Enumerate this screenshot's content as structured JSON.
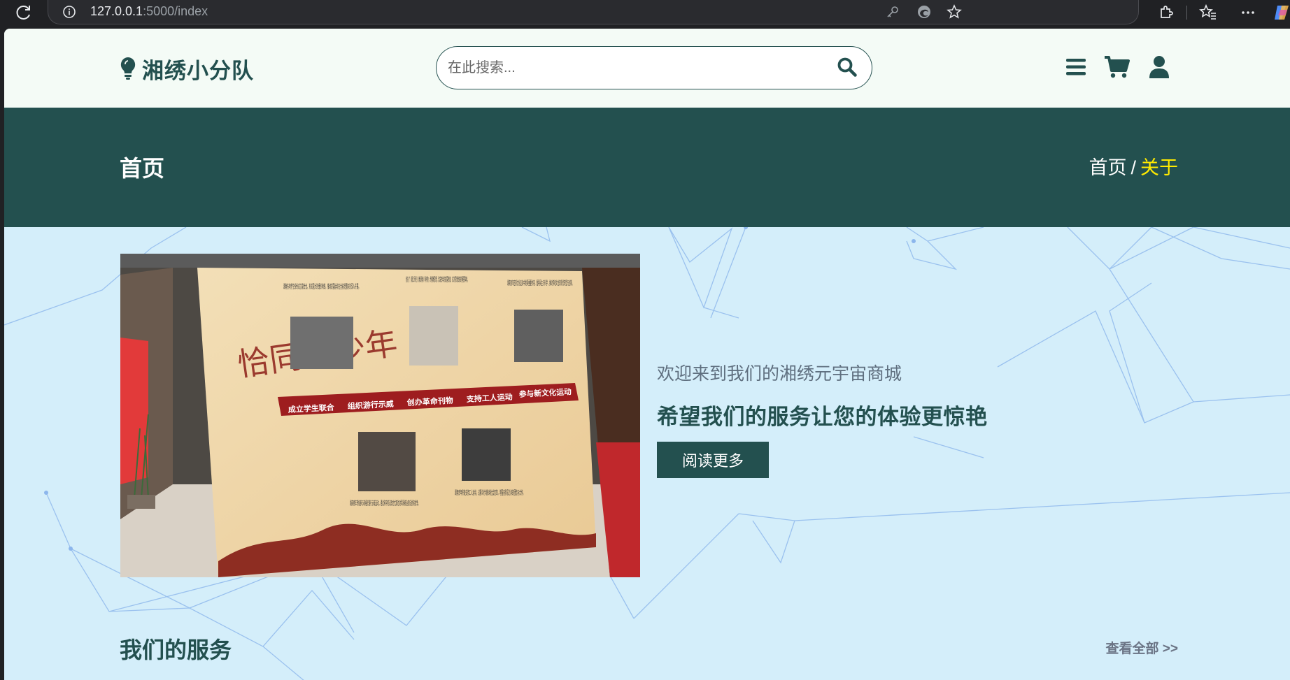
{
  "browser": {
    "url_host": "127.0.0.1",
    "url_rest": ":5000/index"
  },
  "header": {
    "brand": "湘绣小分队",
    "search_placeholder": "在此搜索..."
  },
  "banner": {
    "page_title": "首页",
    "breadcrumb_home": "首页",
    "breadcrumb_sep": "/",
    "breadcrumb_current": "关于"
  },
  "about": {
    "subtitle": "欢迎来到我们的湘绣元宇宙商城",
    "headline": "希望我们的服务让您的体验更惊艳",
    "button": "阅读更多",
    "image": {
      "wall_title": "恰同学少年",
      "timeline": [
        "成立学生联合",
        "组织游行示威",
        "创办革命刊物",
        "支持工人运动",
        "参与新文化运动"
      ],
      "captions": [
        "湖南各地学生纷纷成立联合会，形成强大的组织网络，推动爱国运动在全省范围内的深入开展。",
        "创办了《湘江评论》《新湖南》等刊物，传播新思想，激发青年的爱国热情，成为思想启蒙的重要阵地。",
        "湖南青年在新文化运动中发挥重要作用，倡导民主与科学，推动传统文化的现代转型与创新。",
        "湖南青年积极参与和组织游行示威运动，通过和平的议政方式表达对军阀统治的反抗和抗争。",
        "湖南青年积极支持工人运动，过群众行动推动社会变革，增强各阶层之间的团结与合作。"
      ]
    }
  },
  "services": {
    "title": "我们的服务",
    "view_all": "查看全部 >>"
  },
  "colors": {
    "primary": "#23504f",
    "breadcrumb_active": "#ffea00",
    "page_bg": "#d4eefa"
  }
}
